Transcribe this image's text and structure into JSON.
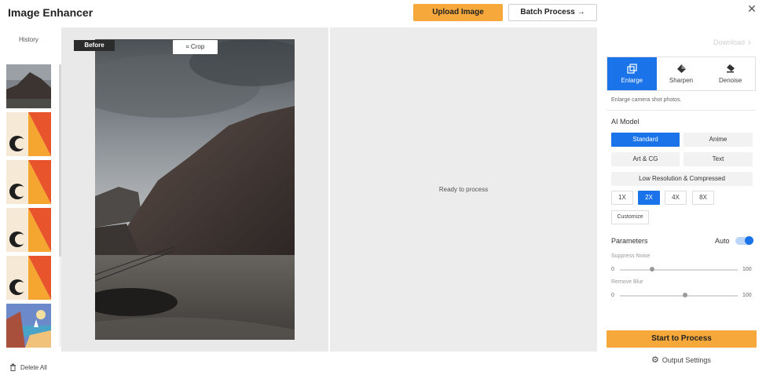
{
  "header": {
    "title": "Image Enhancer",
    "upload_label": "Upload Image",
    "batch_label": "Batch Process →",
    "close_glyph": "✕"
  },
  "history": {
    "label": "History",
    "items": [
      {
        "name": "mountain-photo"
      },
      {
        "name": "orange-shapes-1"
      },
      {
        "name": "orange-shapes-2"
      },
      {
        "name": "orange-shapes-3"
      },
      {
        "name": "orange-shapes-4"
      },
      {
        "name": "beach-painting"
      }
    ],
    "delete_label": "Delete All"
  },
  "canvas": {
    "before_label": "Before",
    "crop_label": "Crop",
    "ready_text": "Ready to process"
  },
  "panel": {
    "download_label": "Download",
    "tabs": [
      {
        "label": "Enlarge",
        "icon": "enlarge-icon",
        "active": true
      },
      {
        "label": "Sharpen",
        "icon": "sharpen-icon",
        "active": false
      },
      {
        "label": "Denoise",
        "icon": "denoise-icon",
        "active": false
      }
    ],
    "description": "Enlarge camera shot photos.",
    "ai_model_label": "AI Model",
    "models": {
      "standard": "Standard",
      "anime": "Anime",
      "art": "Art & CG",
      "text": "Text",
      "lowres": "Low Resolution & Compressed"
    },
    "scales": [
      "1X",
      "2X",
      "4X",
      "8X"
    ],
    "customize_label": "Customize",
    "parameters_label": "Parameters",
    "auto_label": "Auto",
    "auto_on": true,
    "sliders": [
      {
        "label": "Suppress Noise",
        "min": "0",
        "max": "100",
        "value": 27
      },
      {
        "label": "Remove Blur",
        "min": "0",
        "max": "100",
        "value": 55
      }
    ],
    "start_label": "Start to Process",
    "output_label": "Output Settings"
  },
  "colors": {
    "accent_orange": "#f7a83a",
    "accent_blue": "#1a73e8"
  }
}
